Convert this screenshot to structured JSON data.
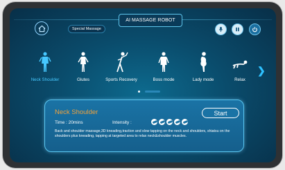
{
  "header": {
    "special_label": "Special Massage",
    "title": "AI MASSAGE ROBOT",
    "icons": [
      "home-icon",
      "microphone-icon",
      "pause-icon",
      "power-icon"
    ]
  },
  "modes": [
    {
      "label": "Neck Shoulder",
      "active": true
    },
    {
      "label": "Glutes",
      "active": false
    },
    {
      "label": "Sports Recovery",
      "active": false
    },
    {
      "label": "Boss mode",
      "active": false
    },
    {
      "label": "Lady mode",
      "active": false
    },
    {
      "label": "Relax",
      "active": false
    }
  ],
  "pager": {
    "current": 1,
    "total": 2
  },
  "detail": {
    "title": "Neck Shoulder",
    "time_text": "Time : 20mins",
    "intensity_label": "Intensity :",
    "intensity_levels": 5,
    "start_label": "Start",
    "description": "Back and shoulder massage,3D kneading,traction and slow tapping on the neck and shoulders, shiatsu on the shoulders plus kneading, tapping at targeted area to relax neck&shoulder muscles."
  },
  "colors": {
    "accent": "#46c8ff",
    "title_orange": "#f2a23c",
    "card": "#1a73a5"
  }
}
